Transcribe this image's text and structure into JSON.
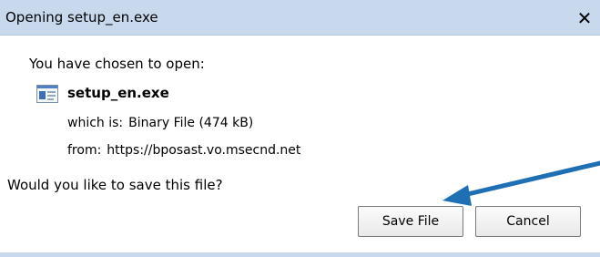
{
  "window": {
    "title": "Opening setup_en.exe",
    "close_glyph": "✕"
  },
  "content": {
    "prompt": "You have chosen to open:",
    "file": {
      "icon": "application-file-icon",
      "name": "setup_en.exe"
    },
    "which_label": "which is:",
    "which_value": "Binary File (474 kB)",
    "from_label": "from:",
    "from_value": "https://bposast.vo.msecnd.net",
    "question": "Would you like to save this file?"
  },
  "buttons": {
    "save_label": "Save File",
    "cancel_label": "Cancel"
  },
  "annotation": {
    "icon": "blue-arrow-pointing-to-save-button",
    "color": "#1f6fb5"
  },
  "colors": {
    "titlebar": "#c8d9ee"
  }
}
